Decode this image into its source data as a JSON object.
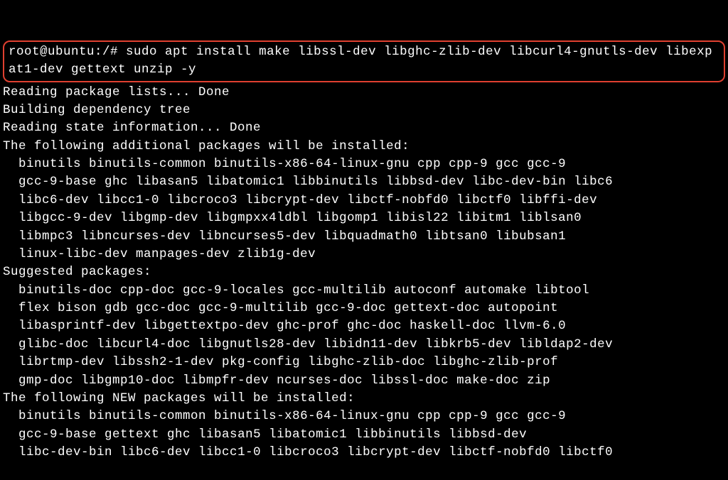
{
  "terminal": {
    "highlighted": {
      "prompt": "root@ubuntu:/#",
      "command": "sudo apt install make libssl-dev libghc-zlib-dev libcurl4-gnutls-dev libexpat1-dev gettext unzip -y"
    },
    "lines": [
      "Reading package lists... Done",
      "Building dependency tree",
      "Reading state information... Done",
      "The following additional packages will be installed:",
      "  binutils binutils-common binutils-x86-64-linux-gnu cpp cpp-9 gcc gcc-9",
      "  gcc-9-base ghc libasan5 libatomic1 libbinutils libbsd-dev libc-dev-bin libc6",
      "  libc6-dev libcc1-0 libcroco3 libcrypt-dev libctf-nobfd0 libctf0 libffi-dev",
      "  libgcc-9-dev libgmp-dev libgmpxx4ldbl libgomp1 libisl22 libitm1 liblsan0",
      "  libmpc3 libncurses-dev libncurses5-dev libquadmath0 libtsan0 libubsan1",
      "  linux-libc-dev manpages-dev zlib1g-dev",
      "Suggested packages:",
      "  binutils-doc cpp-doc gcc-9-locales gcc-multilib autoconf automake libtool",
      "  flex bison gdb gcc-doc gcc-9-multilib gcc-9-doc gettext-doc autopoint",
      "  libasprintf-dev libgettextpo-dev ghc-prof ghc-doc haskell-doc llvm-6.0",
      "  glibc-doc libcurl4-doc libgnutls28-dev libidn11-dev libkrb5-dev libldap2-dev",
      "  librtmp-dev libssh2-1-dev pkg-config libghc-zlib-doc libghc-zlib-prof",
      "  gmp-doc libgmp10-doc libmpfr-dev ncurses-doc libssl-doc make-doc zip",
      "The following NEW packages will be installed:",
      "  binutils binutils-common binutils-x86-64-linux-gnu cpp cpp-9 gcc gcc-9",
      "  gcc-9-base gettext ghc libasan5 libatomic1 libbinutils libbsd-dev",
      "  libc-dev-bin libc6-dev libcc1-0 libcroco3 libcrypt-dev libctf-nobfd0 libctf0"
    ]
  }
}
